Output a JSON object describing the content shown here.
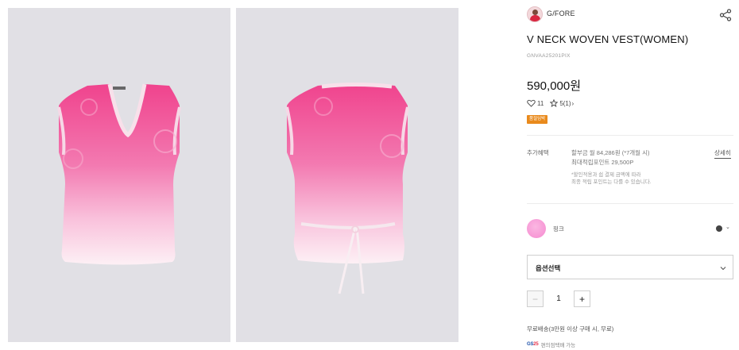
{
  "brand": {
    "name": "G/FORE",
    "avatar": "brand-avatar"
  },
  "product": {
    "title": "V NECK WOVEN VEST(WOMEN)",
    "sku": "GNVAA25201PIX",
    "price": "590,000원",
    "likes": "11",
    "rating": "5",
    "reviews": "(1)",
    "badge": "품절임박"
  },
  "benefits": {
    "label": "추가혜택",
    "installment": "할부금 월 84,286원 (*7개월 시)",
    "points": "최대적립포인트 29,500P",
    "note1": "*할인적용과 쉽 결제 금액에 따라",
    "note2": "최종 적립 포인트는 다를 수 있습니다.",
    "detail_link": "상세히"
  },
  "color": {
    "name": "핑크",
    "swatch": "#f7a6da",
    "selected_dot": "#444444"
  },
  "option": {
    "label": "옵션선택"
  },
  "quantity": {
    "value": "1",
    "minus": "−",
    "plus": "+"
  },
  "shipping": {
    "text": "무료배송(3만원 이상 구매 시, 무료)",
    "pickup_brand_a": "GS",
    "pickup_brand_b": "25",
    "pickup_text": "편의점택배 가능"
  },
  "icons": {
    "share": "share-icon",
    "heart": "heart-icon",
    "star": "star-icon",
    "chevron": "chevron-down-icon"
  },
  "colors": {
    "accent_badge": "#e98a1c",
    "photo_bg": "#e1e0e5",
    "vest_pink": "#f0448f"
  }
}
